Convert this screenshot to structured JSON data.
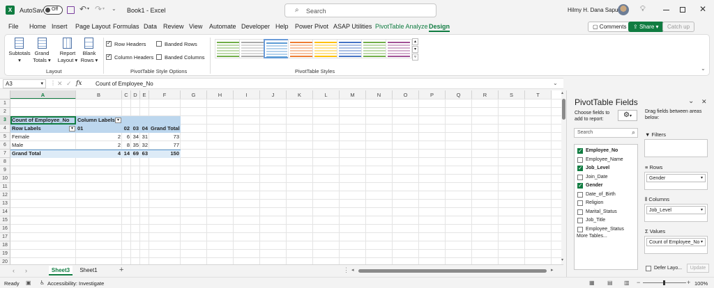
{
  "titlebar": {
    "autosave_label": "AutoSave",
    "autosave_state": "Off",
    "doc_title": "Book1  -  Excel",
    "search_placeholder": "Search",
    "user_name": "Hilmy H. Dana Saputra"
  },
  "menu": {
    "items": [
      "File",
      "Home",
      "Insert",
      "Page Layout",
      "Formulas",
      "Data",
      "Review",
      "View",
      "Automate",
      "Developer",
      "Help",
      "Power Pivot",
      "ASAP Utilities",
      "PivotTable Analyze",
      "Design"
    ],
    "comments_label": "Comments",
    "share_label": "Share",
    "catchup_label": "Catch up"
  },
  "ribbon": {
    "subtotals": "Subtotals",
    "grand_totals": [
      "Grand",
      "Totals"
    ],
    "report_layout": [
      "Report",
      "Layout"
    ],
    "blank_rows": [
      "Blank",
      "Rows"
    ],
    "layout_group": "Layout",
    "row_headers": "Row Headers",
    "column_headers": "Column Headers",
    "banded_rows": "Banded Rows",
    "banded_columns": "Banded Columns",
    "style_options_group": "PivotTable Style Options",
    "styles_group": "PivotTable Styles",
    "style_colors": [
      "#70ad47",
      "#a9a9a9",
      "#5b9bd5",
      "#ed7d31",
      "#ffc000",
      "#4472c4",
      "#70ad47",
      "#a05195"
    ]
  },
  "formula_bar": {
    "name_box": "A3",
    "fx": "fx",
    "formula": "Count of Employee_No"
  },
  "grid": {
    "columns": [
      "A",
      "B",
      "C",
      "D",
      "E",
      "F",
      "G",
      "H",
      "I",
      "J",
      "K",
      "L",
      "M",
      "N",
      "O",
      "P",
      "Q",
      "R",
      "S",
      "T"
    ],
    "rows": [
      "1",
      "2",
      "3",
      "4",
      "5",
      "6",
      "7",
      "8",
      "9",
      "10",
      "11",
      "12",
      "13",
      "14",
      "15",
      "16",
      "17",
      "18",
      "19",
      "20"
    ],
    "pivot": {
      "value_field": "Count of Employee_No",
      "column_labels": "Column Labels",
      "row_labels": "Row Labels",
      "col_keys": [
        "01",
        "02",
        "03",
        "04",
        "Grand Total"
      ],
      "rows": [
        {
          "label": "Female",
          "values": [
            "2",
            "6",
            "34",
            "31",
            "73"
          ]
        },
        {
          "label": "Male",
          "values": [
            "2",
            "8",
            "35",
            "32",
            "77"
          ]
        }
      ],
      "total_label": "Grand Total",
      "total_values": [
        "4",
        "14",
        "69",
        "63",
        "150"
      ]
    }
  },
  "sheets": [
    "Sheet3",
    "Sheet1"
  ],
  "status": {
    "ready": "Ready",
    "accessibility": "Accessibility: Investigate",
    "zoom": "100%"
  },
  "pivot_pane": {
    "title": "PivotTable Fields",
    "choose_fields": "Choose fields to add to report:",
    "drag_fields": "Drag fields between areas below:",
    "search_placeholder": "Search",
    "fields": [
      {
        "name": "Employee_No",
        "checked": true
      },
      {
        "name": "Employee_Name",
        "checked": false
      },
      {
        "name": "Job_Level",
        "checked": true
      },
      {
        "name": "Join_Date",
        "checked": false
      },
      {
        "name": "Gender",
        "checked": true
      },
      {
        "name": "Date_of_Birth",
        "checked": false
      },
      {
        "name": "Religion",
        "checked": false
      },
      {
        "name": "Marital_Status",
        "checked": false
      },
      {
        "name": "Job_Title",
        "checked": false
      },
      {
        "name": "Employee_Status",
        "checked": false
      }
    ],
    "more_tables": "More Tables...",
    "filters_label": "Filters",
    "rows_label": "Rows",
    "rows_value": "Gender",
    "columns_label": "Columns",
    "columns_value": "Job_Level",
    "values_label": "Values",
    "values_value": "Count of Employee_No",
    "defer_label": "Defer Layo...",
    "update_label": "Update"
  }
}
